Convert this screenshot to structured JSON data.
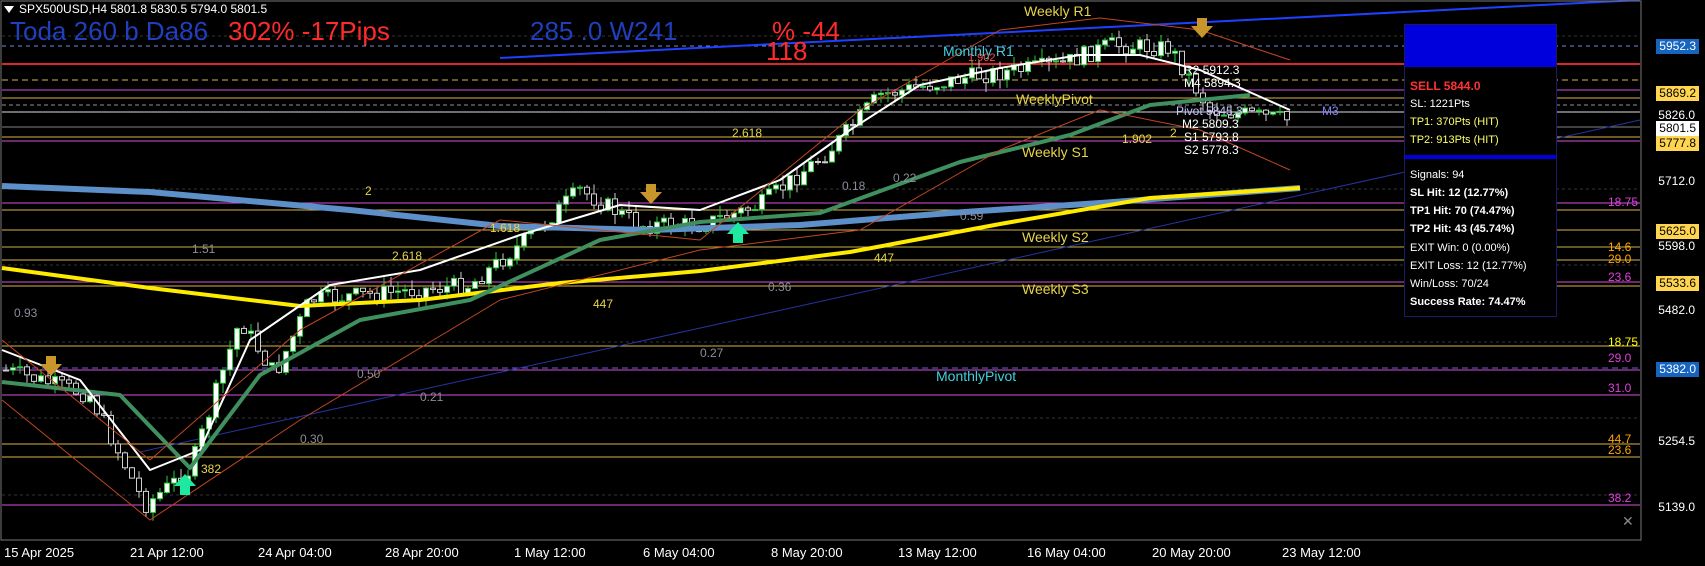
{
  "symbol_bar": "SPX500USD,H4  5801.8 5830.5 5794.0 5801.5",
  "overlays": {
    "today": "Toda 260 b Da86",
    "today_pct": "302% -17Pips",
    "week": "285 .0 W241",
    "week_pct": "% -44",
    "week_value": "118"
  },
  "levels": {
    "weekly_r1": "Weekly R1",
    "monthly_r1": "Monthly R1",
    "r1_value": "1.902",
    "weekly_pivot": "WeeklyPivot",
    "weekly_s1": "Weekly S1",
    "weekly_s2": "Weekly S2",
    "weekly_s3": "Weekly S3",
    "monthly_pivot": "MonthlyPivot",
    "pivot": "Pivot 5845.3",
    "m3": "M3",
    "r2": "R2 5912.3",
    "m4": "M4 5894.3",
    "m2": "M2 5809.3",
    "s1": "S1 5793.8",
    "s2": "S2 5778.3"
  },
  "fib_labels": [
    "2.618",
    "2",
    "1.902",
    "2",
    "1.618",
    "2.618",
    "1.51",
    "0.93",
    "0.22",
    "0.18",
    "0.59",
    "0.36",
    "0.27",
    "0.50",
    "0.21",
    "0.30"
  ],
  "counts": [
    "447",
    "447",
    "382"
  ],
  "right_labels": [
    {
      "text": "18.75",
      "color": "#e040e0"
    },
    {
      "text": "14.6",
      "color": "#ffa500"
    },
    {
      "text": "29.0",
      "color": "#ffa500"
    },
    {
      "text": "23.6",
      "color": "#e040e0"
    },
    {
      "text": "18.75",
      "color": "#ffff00"
    },
    {
      "text": "29.0",
      "color": "#e040e0"
    },
    {
      "text": "31.0",
      "color": "#e040e0"
    },
    {
      "text": "44.7",
      "color": "#ffa500"
    },
    {
      "text": "23.6",
      "color": "#ffa500"
    },
    {
      "text": "38.2",
      "color": "#e040e0"
    }
  ],
  "price_tags": [
    {
      "text": "5952.3",
      "bg": "#1565c0",
      "fg": "#ffffff"
    },
    {
      "text": "5869.2",
      "bg": "#ffd54f",
      "fg": "#000000"
    },
    {
      "text": "5801.5",
      "bg": "#ffffff",
      "fg": "#000000"
    },
    {
      "text": "5777.8",
      "bg": "#ffd54f",
      "fg": "#000000"
    },
    {
      "text": "5625.0",
      "bg": "#ffd54f",
      "fg": "#000000"
    },
    {
      "text": "5533.6",
      "bg": "#ffd54f",
      "fg": "#000000"
    },
    {
      "text": "5382.0",
      "bg": "#1565c0",
      "fg": "#ffffff"
    }
  ],
  "price_axis": [
    "5826.0",
    "5712.0",
    "5598.0",
    "5482.0",
    "5254.5",
    "5139.0"
  ],
  "time_axis": [
    "15 Apr 2025",
    "21 Apr 12:00",
    "24 Apr 04:00",
    "28 Apr 20:00",
    "1 May 12:00",
    "6 May 04:00",
    "8 May 20:00",
    "13 May 12:00",
    "16 May 04:00",
    "20 May 20:00",
    "23 May 12:00"
  ],
  "panel": {
    "sell": "SELL 5844.0",
    "sl": "SL: 1221Pts",
    "tp1": "TP1: 370Pts (HIT)",
    "tp2": "TP2: 913Pts (HIT)",
    "signals": "Signals: 94",
    "sl_hit": "SL Hit: 12 (12.77%)",
    "tp1_hit": "TP1 Hit: 70 (74.47%)",
    "tp2_hit": "TP2 Hit: 43 (45.74%)",
    "exit_win": "EXIT Win: 0 (0.00%)",
    "exit_loss": "EXIT Loss: 12 (12.77%)",
    "win_loss": "Win/Loss: 70/24",
    "success": "Success Rate: 74.47%"
  },
  "colors": {
    "bull": "#ffffff",
    "bear": "#ffffff",
    "panel_accent": "#0000dd",
    "sell": "#ff3333",
    "tp": "#ffff66"
  }
}
